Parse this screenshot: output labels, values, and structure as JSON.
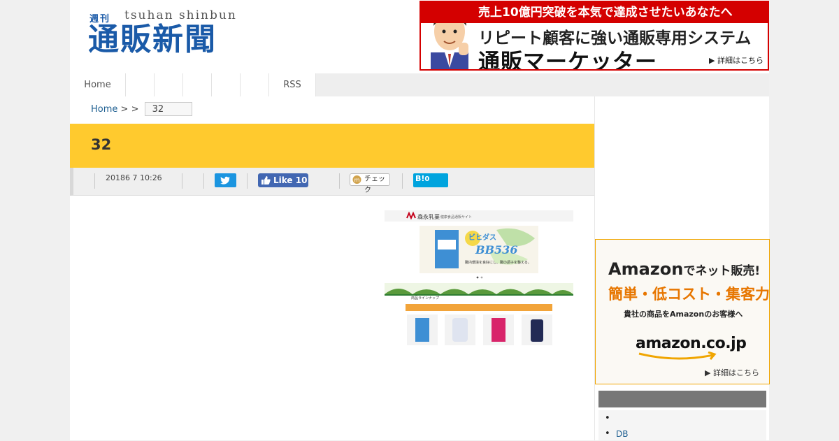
{
  "header": {
    "logo": {
      "small": "週刊",
      "roman": "tsuhan shinbun",
      "main": "通販新聞"
    },
    "banner": {
      "top": "売上10億円突破を本気で達成させたいあなたへ",
      "mid": "リピート顧客に強い通販専用システム",
      "big": "通販マーケッター",
      "more": "▶ 詳細はこちら"
    }
  },
  "nav": {
    "items": [
      {
        "label": "Home"
      },
      {
        "label": ""
      },
      {
        "label": ""
      },
      {
        "label": ""
      },
      {
        "label": ""
      },
      {
        "label": ""
      },
      {
        "label": "RSS"
      }
    ]
  },
  "breadcrumb": {
    "home": "Home",
    "sep1": ">",
    "sep2": ">",
    "current": "32"
  },
  "article": {
    "title": "32",
    "date": "20186 7 10:26",
    "share": {
      "facebook": "Like 10",
      "mixi": "チェック",
      "hatena_logo": "B!",
      "hatena_count": "0"
    },
    "image": {
      "brand": "森永乳業",
      "brand_sub": "健康食品通販サイト",
      "product": "ビヒダス",
      "product_code": "BB536",
      "badge": "腸内環境を良好にし、腸の調子を整える。",
      "lineup": "商品ラインナップ"
    }
  },
  "sidebar": {
    "amazon": {
      "h1": "Amazon",
      "h1_suffix": "でネット販売!",
      "h2": "簡単・低コスト・集客力",
      "p": "貴社の商品をAmazonのお客様へ",
      "logo": "amazon.co.jp",
      "more": "▶ 詳細はこちら"
    },
    "list": [
      {
        "label": ""
      },
      {
        "label": "DB"
      }
    ]
  },
  "colors": {
    "accent": "#ffca2e",
    "brand": "#1a5aa8",
    "banner_red": "#d40000",
    "amazon_orange": "#e77600"
  }
}
